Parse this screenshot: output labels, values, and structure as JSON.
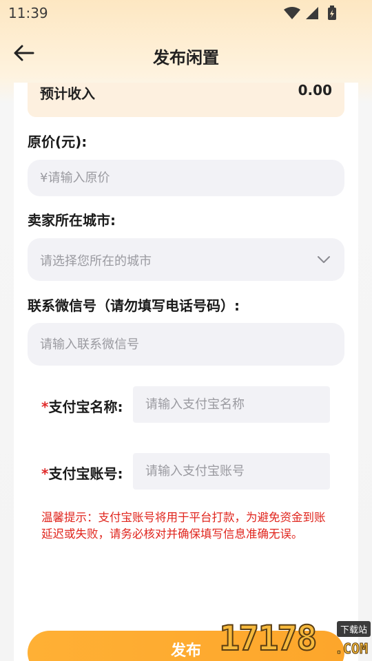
{
  "status_bar": {
    "time": "11:39"
  },
  "header": {
    "title": "发布闲置"
  },
  "income": {
    "label": "预计收入",
    "value": "0.00"
  },
  "original_price": {
    "label": "原价(元):",
    "placeholder": "¥请输入原价"
  },
  "city": {
    "label": "卖家所在城市:",
    "placeholder": "请选择您所在的城市"
  },
  "wechat": {
    "label": "联系微信号（请勿填写电话号码）:",
    "placeholder": "请输入联系微信号"
  },
  "alipay_name": {
    "required_mark": "*",
    "label": "支付宝名称:",
    "placeholder": "请输入支付宝名称"
  },
  "alipay_account": {
    "required_mark": "*",
    "label": "支付宝账号:",
    "placeholder": "请输入支付宝账号"
  },
  "warning": "温馨提示：支付宝账号将用于平台打款，为避免资金到账延迟或失败，请务必核对并确保填写信息准确无误。",
  "publish_button": "发布",
  "watermark": {
    "number": "17178",
    "tag": "下载站",
    "suffix": ".COM"
  },
  "colors": {
    "accent": "#fda62b",
    "warning": "#e0251d",
    "input_bg": "#f2f2f6",
    "income_bg": "#fdf0df"
  }
}
